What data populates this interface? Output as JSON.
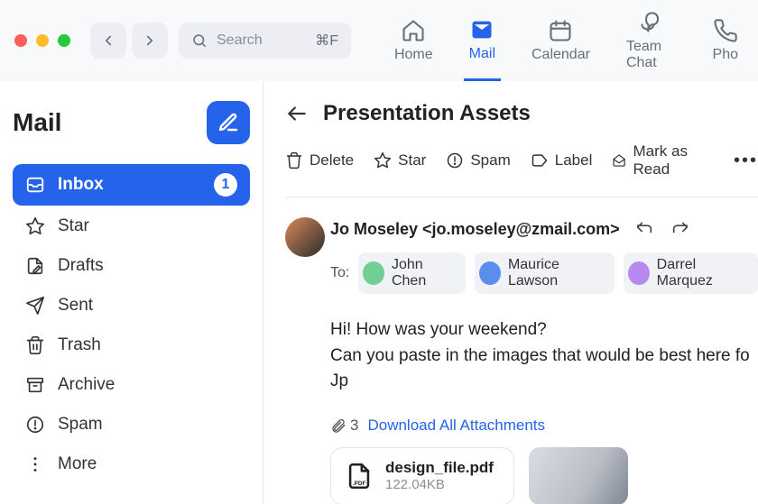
{
  "topbar": {
    "search_placeholder": "Search",
    "search_shortcut": "⌘F",
    "tabs": [
      {
        "label": "Home"
      },
      {
        "label": "Mail"
      },
      {
        "label": "Calendar"
      },
      {
        "label": "Team Chat"
      },
      {
        "label": "Pho"
      }
    ]
  },
  "sidebar": {
    "title": "Mail",
    "folders": [
      {
        "label": "Inbox",
        "badge": "1"
      },
      {
        "label": "Star"
      },
      {
        "label": "Drafts"
      },
      {
        "label": "Sent"
      },
      {
        "label": "Trash"
      },
      {
        "label": "Archive"
      },
      {
        "label": "Spam"
      },
      {
        "label": "More"
      }
    ]
  },
  "mail": {
    "subject": "Presentation Assets",
    "toolbar": {
      "delete": "Delete",
      "star": "Star",
      "spam": "Spam",
      "label": "Label",
      "mark_read": "Mark as Read"
    },
    "sender_display": "Jo Moseley <jo.moseley@zmail.com>",
    "to_label": "To:",
    "recipients": [
      {
        "name": "John Chen",
        "color": "#6fcf97"
      },
      {
        "name": "Maurice Lawson",
        "color": "#5b8def"
      },
      {
        "name": "Darrel Marquez",
        "color": "#b889f0"
      }
    ],
    "body_line1": "Hi! How was your weekend?",
    "body_line2": "Can you paste in the images that would be best here fo",
    "body_line3": "Jp",
    "attachments_count": "3",
    "download_all": "Download All Attachments",
    "file_name": "design_file.pdf",
    "file_size": "122.04KB"
  }
}
